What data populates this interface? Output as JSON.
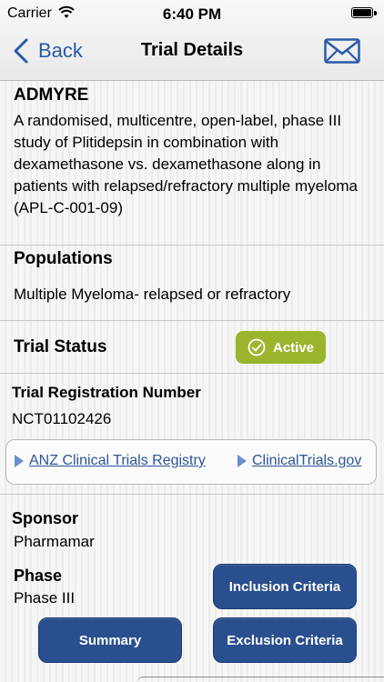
{
  "status_bar": {
    "carrier": "Carrier",
    "time": "6:40 PM"
  },
  "nav": {
    "back_label": "Back",
    "title": "Trial Details"
  },
  "trial": {
    "acronym": "ADMYRE",
    "description": "A randomised, multicentre, open-label, phase III study of Plitidepsin in combination with dexamethasone vs. dexamethasone along in patients with relapsed/refractory multiple myeloma (APL-C-001-09)"
  },
  "populations": {
    "heading": "Populations",
    "value": "Multiple Myeloma- relapsed or refractory"
  },
  "trial_status": {
    "heading": "Trial Status",
    "badge": "Active",
    "badge_color": "#9bb52e"
  },
  "registration": {
    "heading": "Trial Registration Number",
    "value": "NCT01102426"
  },
  "links": [
    {
      "label": "ANZ Clinical Trials Registry"
    },
    {
      "label": "ClinicalTrials.gov"
    }
  ],
  "sponsor": {
    "heading": "Sponsor",
    "value": "Pharmamar"
  },
  "phase": {
    "heading": "Phase",
    "value": "Phase III"
  },
  "buttons": {
    "inclusion": "Inclusion Criteria",
    "summary": "Summary",
    "exclusion": "Exclusion Criteria"
  },
  "icons": {
    "back": "chevron-left-icon",
    "mail": "envelope-icon",
    "wifi": "wifi-icon",
    "battery": "battery-icon",
    "check": "check-circle-icon",
    "link": "triangle-right-icon"
  },
  "colors": {
    "accent": "#2a5aa8",
    "button": "#2a4f8e",
    "active": "#9bb52e"
  }
}
